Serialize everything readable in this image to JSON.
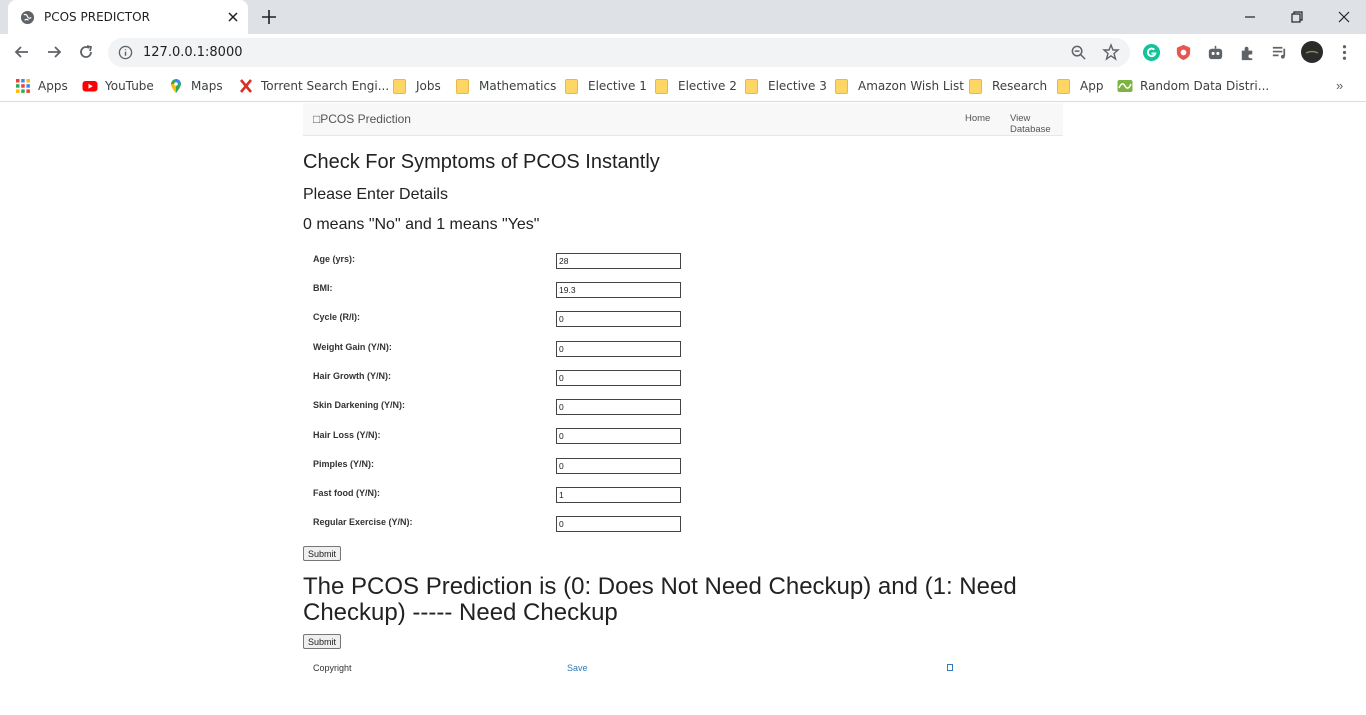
{
  "browser": {
    "tab_title": "PCOS PREDICTOR",
    "url": "127.0.0.1:8000",
    "bookmarks": [
      "Apps",
      "YouTube",
      "Maps",
      "Torrent Search Engi...",
      "Jobs",
      "Mathematics",
      "Elective 1",
      "Elective 2",
      "Elective 3",
      "Amazon Wish List",
      "Research",
      "App",
      "Random Data Distri..."
    ],
    "bookmarks_more": "»"
  },
  "navbar": {
    "brand_icon": "□",
    "brand": "PCOS Prediction",
    "links": [
      "Home",
      "View Database"
    ]
  },
  "page": {
    "title": "Check For Symptoms of PCOS Instantly",
    "subtitle": "Please Enter Details",
    "hint": "0 means \"No\" and 1 means \"Yes\""
  },
  "form": {
    "fields": [
      {
        "label": "Age (yrs):",
        "value": "28"
      },
      {
        "label": "BMI:",
        "value": "19.3"
      },
      {
        "label": "Cycle (R/I):",
        "value": "0"
      },
      {
        "label": "Weight Gain (Y/N):",
        "value": "0"
      },
      {
        "label": "Hair Growth (Y/N):",
        "value": "0"
      },
      {
        "label": "Skin Darkening (Y/N):",
        "value": "0"
      },
      {
        "label": "Hair Loss (Y/N):",
        "value": "0"
      },
      {
        "label": "Pimples (Y/N):",
        "value": "0"
      },
      {
        "label": "Fast food (Y/N):",
        "value": "1"
      },
      {
        "label": "Regular Exercise (Y/N):",
        "value": "0"
      }
    ],
    "submit_label": "Submit"
  },
  "result": {
    "text": "The PCOS Prediction is (0: Does Not Need Checkup) and (1: Need Checkup) ----- Need Checkup",
    "submit_label": "Submit"
  },
  "footer": {
    "copyright": "Copyright",
    "save": "Save"
  },
  "colors": {
    "link_blue": "#337ab7",
    "navbar_bg": "#f8f8f8",
    "tabstrip_bg": "#dee1e6"
  }
}
